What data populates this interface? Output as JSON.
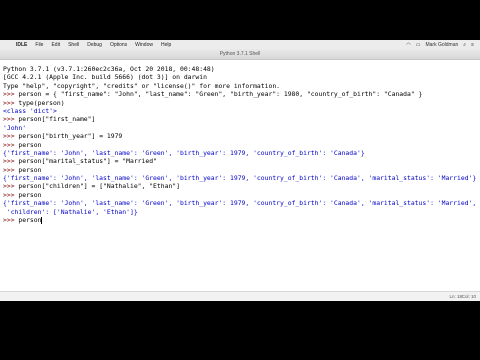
{
  "menubar": {
    "app": "IDLE",
    "items": [
      "File",
      "Edit",
      "Shell",
      "Debug",
      "Options",
      "Window",
      "Help"
    ],
    "user": "Mark Goldman"
  },
  "window": {
    "title": "Python 3.7.1 Shell"
  },
  "shell": {
    "lines": [
      {
        "type": "banner",
        "text": "Python 3.7.1 (v3.7.1:260ec2c36a, Oct 20 2018, 00:48:48)"
      },
      {
        "type": "banner",
        "text": "[GCC 4.2.1 (Apple Inc. build 5666) (dot 3)] on darwin"
      },
      {
        "type": "banner",
        "text": "Type \"help\", \"copyright\", \"credits\" or \"license()\" for more information."
      },
      {
        "type": "input",
        "prompt": ">>> ",
        "text": "person = { \"first_name\": \"John\", \"last_name\": \"Green\", \"birth_year\": 1980, \"country_of_birth\": \"Canada\" }"
      },
      {
        "type": "input",
        "prompt": ">>> ",
        "text": "type(person)"
      },
      {
        "type": "output",
        "text": "<class 'dict'>"
      },
      {
        "type": "input",
        "prompt": ">>> ",
        "text": "person[\"first_name\"]"
      },
      {
        "type": "output",
        "text": "'John'"
      },
      {
        "type": "input",
        "prompt": ">>> ",
        "text": "person[\"birth_year\"] = 1979"
      },
      {
        "type": "input",
        "prompt": ">>> ",
        "text": "person"
      },
      {
        "type": "output",
        "text": "{'first_name': 'John', 'last_name': 'Green', 'birth_year': 1979, 'country_of_birth': 'Canada'}"
      },
      {
        "type": "input",
        "prompt": ">>> ",
        "text": "person[\"marital_status\"] = \"Married\""
      },
      {
        "type": "input",
        "prompt": ">>> ",
        "text": "person"
      },
      {
        "type": "output",
        "text": "{'first_name': 'John', 'last_name': 'Green', 'birth_year': 1979, 'country_of_birth': 'Canada', 'marital_status': 'Married'}"
      },
      {
        "type": "input",
        "prompt": ">>> ",
        "text": "person[\"children\"] = [\"Nathalie\", \"Ethan\"]"
      },
      {
        "type": "input",
        "prompt": ">>> ",
        "text": "person"
      },
      {
        "type": "output",
        "text": "{'first_name': 'John', 'last_name': 'Green', 'birth_year': 1979, 'country_of_birth': 'Canada', 'marital_status': 'Married',"
      },
      {
        "type": "output",
        "text": " 'children': ['Nathalie', 'Ethan']}"
      },
      {
        "type": "input",
        "prompt": ">>> ",
        "text": "person"
      }
    ]
  },
  "status": {
    "line": "Ln: 18",
    "col": "Col: 10"
  }
}
